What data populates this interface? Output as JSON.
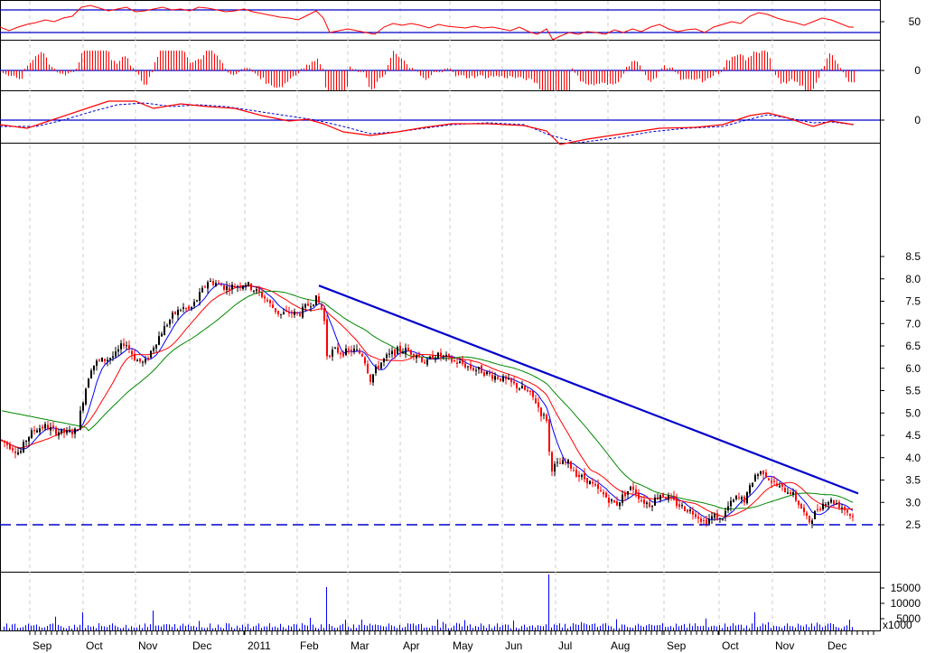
{
  "chart_data": [
    {
      "panel": "rsi",
      "type": "line",
      "y_ticks": [
        "50"
      ],
      "ref_levels": [
        60,
        40
      ],
      "color": "#ff0000",
      "line_color": "#0000cc"
    },
    {
      "panel": "momentum-histogram",
      "type": "bar",
      "y_ticks": [
        "0"
      ],
      "color": "#ff0000"
    },
    {
      "panel": "macd",
      "type": "line",
      "y_ticks": [
        "0"
      ],
      "series_colors": [
        "#ff0000",
        "#0000cc"
      ]
    },
    {
      "panel": "price",
      "type": "candlestick",
      "y_ticks": [
        "8.5",
        "8.0",
        "7.5",
        "7.0",
        "6.5",
        "6.0",
        "5.5",
        "5.0",
        "4.5",
        "4.0",
        "3.5",
        "3.0",
        "2.5"
      ],
      "ylim": [
        2.25,
        8.75
      ],
      "up_color": "#000000",
      "down_color": "#ff0000",
      "moving_averages": [
        {
          "color": "#0000ff"
        },
        {
          "color": "#ff0000"
        },
        {
          "color": "#008800"
        }
      ],
      "trendline": {
        "from": [
          "Feb",
          7.85
        ],
        "to": [
          "Dec",
          3.2
        ],
        "color": "#0000cc"
      },
      "support_line": {
        "value": 2.5,
        "style": "dashed",
        "color": "#0000cc"
      },
      "path_anchors": [
        [
          0,
          4.4
        ],
        [
          12,
          4.25
        ],
        [
          22,
          4.1
        ],
        [
          30,
          4.45
        ],
        [
          40,
          4.65
        ],
        [
          50,
          4.7
        ],
        [
          60,
          4.6
        ],
        [
          75,
          4.55
        ],
        [
          85,
          4.6
        ],
        [
          92,
          5.3
        ],
        [
          100,
          6.0
        ],
        [
          108,
          6.15
        ],
        [
          118,
          6.2
        ],
        [
          128,
          6.3
        ],
        [
          138,
          6.6
        ],
        [
          150,
          6.2
        ],
        [
          160,
          6.1
        ],
        [
          170,
          6.5
        ],
        [
          180,
          6.85
        ],
        [
          192,
          7.2
        ],
        [
          202,
          7.35
        ],
        [
          210,
          7.3
        ],
        [
          220,
          7.6
        ],
        [
          230,
          7.95
        ],
        [
          240,
          7.9
        ],
        [
          250,
          7.8
        ],
        [
          262,
          7.85
        ],
        [
          272,
          7.9
        ],
        [
          282,
          7.75
        ],
        [
          292,
          7.6
        ],
        [
          300,
          7.4
        ],
        [
          310,
          7.2
        ],
        [
          320,
          7.25
        ],
        [
          330,
          7.2
        ],
        [
          340,
          7.4
        ],
        [
          350,
          7.55
        ],
        [
          358,
          7.3
        ],
        [
          362,
          6.3
        ],
        [
          370,
          6.4
        ],
        [
          380,
          6.35
        ],
        [
          392,
          6.4
        ],
        [
          402,
          6.3
        ],
        [
          410,
          5.75
        ],
        [
          418,
          6.05
        ],
        [
          428,
          6.25
        ],
        [
          440,
          6.4
        ],
        [
          450,
          6.4
        ],
        [
          462,
          6.3
        ],
        [
          472,
          6.1
        ],
        [
          480,
          6.3
        ],
        [
          492,
          6.25
        ],
        [
          502,
          6.15
        ],
        [
          512,
          6.1
        ],
        [
          522,
          6.0
        ],
        [
          532,
          5.95
        ],
        [
          542,
          5.85
        ],
        [
          552,
          5.8
        ],
        [
          562,
          5.7
        ],
        [
          572,
          5.6
        ],
        [
          582,
          5.5
        ],
        [
          592,
          5.3
        ],
        [
          600,
          4.95
        ],
        [
          606,
          4.85
        ],
        [
          609,
          3.75
        ],
        [
          618,
          3.85
        ],
        [
          628,
          3.9
        ],
        [
          640,
          3.6
        ],
        [
          650,
          3.5
        ],
        [
          660,
          3.3
        ],
        [
          672,
          3.1
        ],
        [
          682,
          2.95
        ],
        [
          692,
          3.2
        ],
        [
          700,
          3.35
        ],
        [
          710,
          3.05
        ],
        [
          720,
          2.95
        ],
        [
          730,
          3.2
        ],
        [
          740,
          3.1
        ],
        [
          750,
          2.95
        ],
        [
          760,
          2.85
        ],
        [
          770,
          2.75
        ],
        [
          780,
          2.55
        ],
        [
          790,
          2.7
        ],
        [
          798,
          2.6
        ],
        [
          806,
          2.9
        ],
        [
          815,
          3.1
        ],
        [
          825,
          3.05
        ],
        [
          835,
          3.6
        ],
        [
          845,
          3.7
        ],
        [
          855,
          3.45
        ],
        [
          865,
          3.3
        ],
        [
          875,
          3.25
        ],
        [
          885,
          2.95
        ],
        [
          895,
          2.55
        ],
        [
          905,
          2.85
        ],
        [
          915,
          3.05
        ],
        [
          925,
          3.0
        ],
        [
          935,
          2.85
        ],
        [
          945,
          2.65
        ]
      ]
    },
    {
      "panel": "volume",
      "type": "bar",
      "y_ticks": [
        "15000",
        "10000",
        "5000"
      ],
      "unit_label": "x1000",
      "color": "#0000ff"
    }
  ],
  "x_axis": {
    "months": [
      "Sep",
      "Oct",
      "Nov",
      "Dec",
      "2011",
      "Feb",
      "Mar",
      "Apr",
      "May",
      "Jun",
      "Jul",
      "Aug",
      "Sep",
      "Oct",
      "Nov",
      "Dec"
    ]
  }
}
